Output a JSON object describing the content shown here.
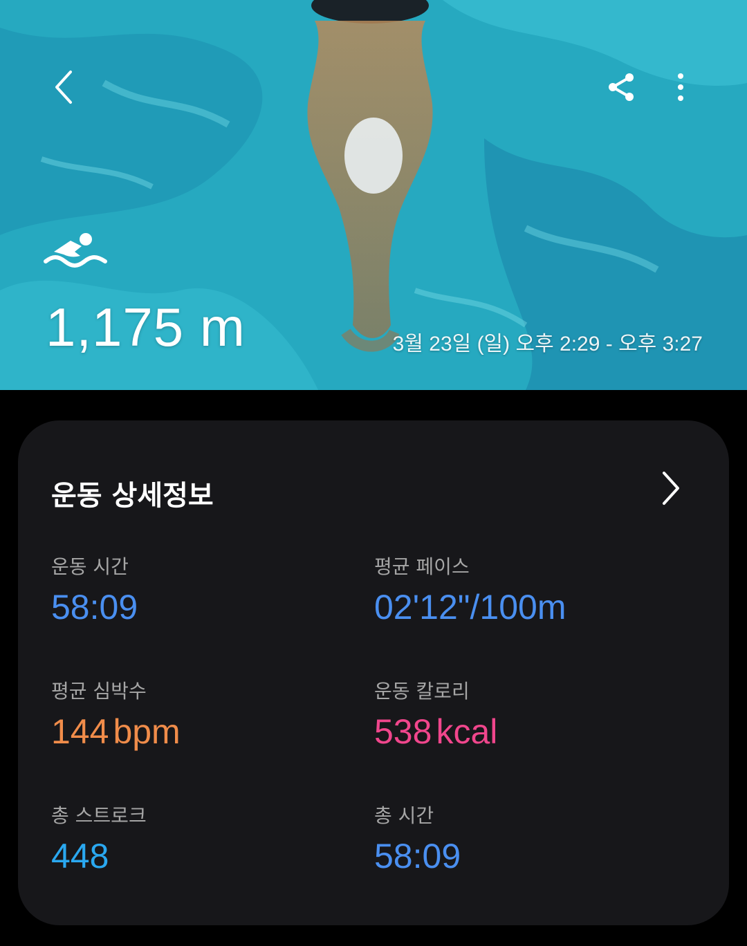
{
  "hero": {
    "distance": "1,175 m",
    "datetime": "3월 23일 (일) 오후 2:29 - 오후 3:27",
    "icons": {
      "back": "chevron-left-icon",
      "share": "share-icon",
      "more": "more-vertical-icon",
      "activity": "swimming-icon"
    }
  },
  "details": {
    "title": "운동 상세정보",
    "stats": [
      {
        "label": "운동 시간",
        "value": "58:09",
        "unit": "",
        "color": "#4a8ff0"
      },
      {
        "label": "평균 페이스",
        "value": "02'12\"/100m",
        "unit": "",
        "color": "#4a8ff0"
      },
      {
        "label": "평균 심박수",
        "value": "144",
        "unit": "bpm",
        "color": "#f08c4a"
      },
      {
        "label": "운동 칼로리",
        "value": "538",
        "unit": "kcal",
        "color": "#f0468c"
      },
      {
        "label": "총 스트로크",
        "value": "448",
        "unit": "",
        "color": "#2aa8f0"
      },
      {
        "label": "총 시간",
        "value": "58:09",
        "unit": "",
        "color": "#4a8ff0"
      }
    ]
  }
}
